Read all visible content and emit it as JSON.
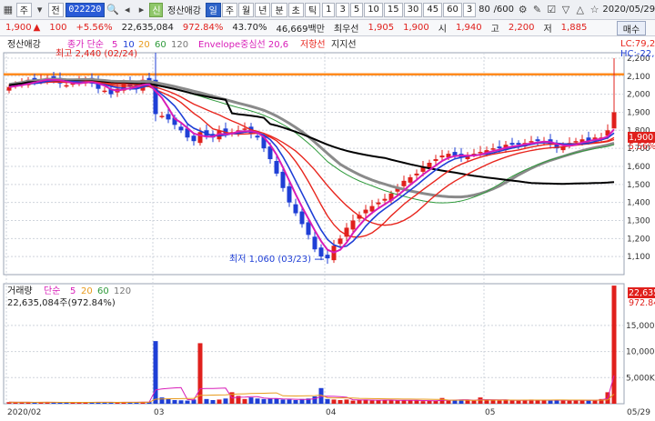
{
  "toolbar": {
    "grid_icon": "grid-icon",
    "mode_label": "주",
    "select_label": "전",
    "code": "022220",
    "search_icon": "search-icon",
    "prev_icon": "prev-icon",
    "next_icon": "next-icon",
    "credit_badge": "신",
    "stock_name": "정산애강",
    "periods": [
      "일",
      "주",
      "월",
      "년",
      "분",
      "초",
      "틱"
    ],
    "active_period": "일",
    "intervals": [
      "1",
      "3",
      "5",
      "10",
      "15",
      "30",
      "45",
      "60",
      "3"
    ],
    "count_value": "80",
    "count_total": "/600",
    "icons": [
      "settings-icon",
      "edit-icon",
      "check-icon",
      "down-icon",
      "up-icon",
      "star-icon"
    ],
    "date": "2020/05/29"
  },
  "quote": {
    "price": "1,900",
    "arrow": "▲",
    "change": "100",
    "change_pct": "+5.56%",
    "volume": "22,635,084",
    "vol_ratio": "972.84%",
    "turnover": "43.70%",
    "amount": "46,669백만",
    "best_ask_label": "최우선",
    "best_ask": "1,905",
    "best_bid": "1,900",
    "open_label": "시",
    "open": "1,940",
    "high_label": "고",
    "high": "2,200",
    "low_label": "저",
    "low": "1,885",
    "buy_button": "매수"
  },
  "legend": {
    "main_name": "정산애강",
    "ma_label": "종가 단순",
    "ma_periods": [
      "5",
      "10",
      "20",
      "60",
      "120"
    ],
    "envelope": "Envelope중심선 20,6",
    "resistance": "저항선",
    "support": "지지선",
    "lc_label": "LC:79,2",
    "hc_label": "HC:-22,",
    "vol_title": "거래량",
    "vol_ma_label": "단순",
    "vol_ma_periods": [
      "5",
      "20",
      "60",
      "120"
    ],
    "vol_value": "22,635,084주(972.84%)",
    "vol_marker": "22,635",
    "vol_marker_pct": "972.84",
    "price_marker": "1,900",
    "price_marker_pct": "5.56%"
  },
  "colors": {
    "up": "#e0201c",
    "down": "#1f3fd6",
    "ma5": "#d81cb8",
    "ma10": "#1f3fd6",
    "ma20": "#e8251d",
    "ma60": "#2e9a3a",
    "ma120": "#000000",
    "envelope": "#8a8a8a",
    "resistance": "#ff8a1e",
    "grid": "#cfd4dc"
  },
  "chart_data": [
    {
      "type": "candlestick",
      "title": "정산애강",
      "ylim": [
        1000,
        2230
      ],
      "y_ticks": [
        2200,
        2100,
        2000,
        1900,
        1800,
        1700,
        1600,
        1500,
        1400,
        1300,
        1200,
        1100
      ],
      "x_ticks": [
        "2020/02",
        "03",
        "04",
        "05",
        "05/29"
      ],
      "annotations": [
        {
          "text": "최고 2,440 (02/24)",
          "value": 2440
        },
        {
          "text": "최저 1,060 (03/23)",
          "value": 1060
        }
      ],
      "resistance_level": 2110,
      "close": [
        2040,
        2050,
        2060,
        2080,
        2070,
        2080,
        2090,
        2080,
        2060,
        2050,
        2060,
        2070,
        2080,
        2060,
        2030,
        2020,
        2000,
        2030,
        2060,
        2040,
        2030,
        2080,
        2070,
        1890,
        1880,
        1860,
        1830,
        1800,
        1760,
        1740,
        1790,
        1770,
        1760,
        1800,
        1780,
        1790,
        1800,
        1810,
        1780,
        1760,
        1700,
        1640,
        1560,
        1480,
        1400,
        1340,
        1280,
        1220,
        1140,
        1100,
        1090,
        1160,
        1200,
        1260,
        1300,
        1330,
        1360,
        1380,
        1400,
        1420,
        1450,
        1480,
        1520,
        1540,
        1560,
        1600,
        1620,
        1640,
        1660,
        1670,
        1660,
        1650,
        1660,
        1670,
        1680,
        1690,
        1700,
        1700,
        1720,
        1720,
        1720,
        1730,
        1740,
        1740,
        1740,
        1720,
        1700,
        1710,
        1730,
        1740,
        1750,
        1740,
        1760,
        1760,
        1800,
        1900
      ],
      "ohlc_notes": "close approximated; open/high/low derived per bar in script",
      "ma5_last": 1750,
      "ma20_last": 1780,
      "ma60_last": 1700,
      "ma120_last": 1620,
      "envelope_last": 1800
    },
    {
      "type": "bar",
      "title": "거래량",
      "y_ticks": [
        "15,000",
        "10,000",
        "5,000K"
      ],
      "ylim": [
        0,
        23000
      ],
      "unit": "K",
      "values": [
        300,
        250,
        280,
        260,
        240,
        300,
        280,
        260,
        220,
        240,
        280,
        260,
        300,
        260,
        280,
        300,
        250,
        260,
        300,
        280,
        300,
        320,
        340,
        12000,
        1200,
        900,
        700,
        650,
        600,
        800,
        11600,
        900,
        700,
        800,
        1000,
        2200,
        1500,
        900,
        1200,
        1000,
        900,
        950,
        1000,
        800,
        800,
        700,
        900,
        1000,
        1400,
        3000,
        900,
        800,
        700,
        800,
        600,
        700,
        800,
        600,
        700,
        650,
        700,
        600,
        700,
        650,
        600,
        500,
        550,
        600,
        1100,
        600,
        650,
        800,
        700,
        600,
        1200,
        650,
        700,
        600,
        650,
        700,
        600,
        650,
        800,
        700,
        650,
        600,
        700,
        650,
        600,
        650,
        650,
        700,
        650,
        900,
        2200,
        22635
      ]
    }
  ]
}
